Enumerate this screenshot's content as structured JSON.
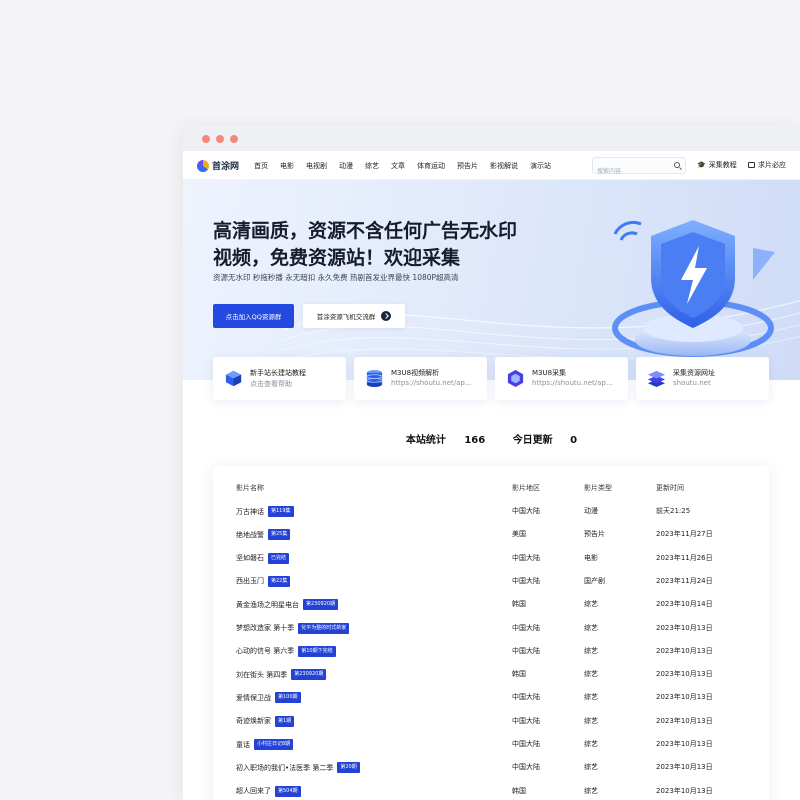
{
  "window": {
    "controls": [
      "close",
      "minimize",
      "maximize"
    ]
  },
  "header": {
    "logo_text": "首涂网",
    "menu": [
      "首页",
      "电影",
      "电视剧",
      "动漫",
      "综艺",
      "文章",
      "体育运动",
      "预告片",
      "影视解说",
      "演示站"
    ],
    "search_placeholder": "搜索内容",
    "link1": "采集教程",
    "link2": "求片必应"
  },
  "hero": {
    "title_line1": "高清画质，资源不含任何广告无水印",
    "title_line2": "视频，免费资源站！欢迎采集",
    "subtitle": "资源无水印 秒拖秒播 永无暗扣 永久免费 热剧首发业界最快 1080P超高清",
    "btn_primary": "点击加入QQ资源群",
    "btn_secondary": "首涂资源飞机交流群"
  },
  "cards": [
    {
      "title": "新手站长建站教程",
      "sub": "点击查看帮助",
      "icon": "cube-icon"
    },
    {
      "title": "M3U8视频解析",
      "sub": "https://shoutu.net/ap...",
      "icon": "database-icon"
    },
    {
      "title": "M3U8采集",
      "sub": "https://shoutu.net/ap...",
      "icon": "box-icon"
    },
    {
      "title": "采集资源网址",
      "sub": "shoutu.net",
      "icon": "layers-icon"
    }
  ],
  "stats": {
    "label_total": "本站统计",
    "total": "166",
    "label_today": "今日更新",
    "today": "0"
  },
  "table": {
    "headers": [
      "影片名称",
      "影片地区",
      "影片类型",
      "更新时间"
    ],
    "rows": [
      {
        "name": "万古神话",
        "badge": "第119集",
        "region": "中国大陆",
        "type": "动漫",
        "time": "前天21:25"
      },
      {
        "name": "绝地战警",
        "badge": "第25集",
        "region": "美国",
        "type": "预告片",
        "time": "2023年11月27日"
      },
      {
        "name": "坚如磐石",
        "badge": "已完结",
        "region": "中国大陆",
        "type": "电影",
        "time": "2023年11月26日"
      },
      {
        "name": "西出玉门",
        "badge": "第22集",
        "region": "中国大陆",
        "type": "国产剧",
        "time": "2023年11月24日"
      },
      {
        "name": "黄金渔场之明星电台",
        "badge": "第230920期",
        "region": "韩国",
        "type": "综艺",
        "time": "2023年10月14日"
      },
      {
        "name": "梦想改造家 第十季",
        "badge": "化平为整的时式新家",
        "region": "中国大陆",
        "type": "综艺",
        "time": "2023年10月13日"
      },
      {
        "name": "心动的信号 第六季",
        "badge": "第10期下完结",
        "region": "中国大陆",
        "type": "综艺",
        "time": "2023年10月13日"
      },
      {
        "name": "刘在街头 第四季",
        "badge": "第230920期",
        "region": "韩国",
        "type": "综艺",
        "time": "2023年10月13日"
      },
      {
        "name": "爱情保卫战",
        "badge": "第100期",
        "region": "中国大陆",
        "type": "综艺",
        "time": "2023年10月13日"
      },
      {
        "name": "奇迹焕新家",
        "badge": "第1期",
        "region": "中国大陆",
        "type": "综艺",
        "time": "2023年10月13日"
      },
      {
        "name": "童话",
        "badge": "小村庄日记8期",
        "region": "中国大陆",
        "type": "综艺",
        "time": "2023年10月13日"
      },
      {
        "name": "初入职场的我们•法医季 第二季",
        "badge": "第20期",
        "region": "中国大陆",
        "type": "综艺",
        "time": "2023年10月13日"
      },
      {
        "name": "超人回来了",
        "badge": "第504期",
        "region": "韩国",
        "type": "综艺",
        "time": "2023年10月13日"
      }
    ]
  }
}
